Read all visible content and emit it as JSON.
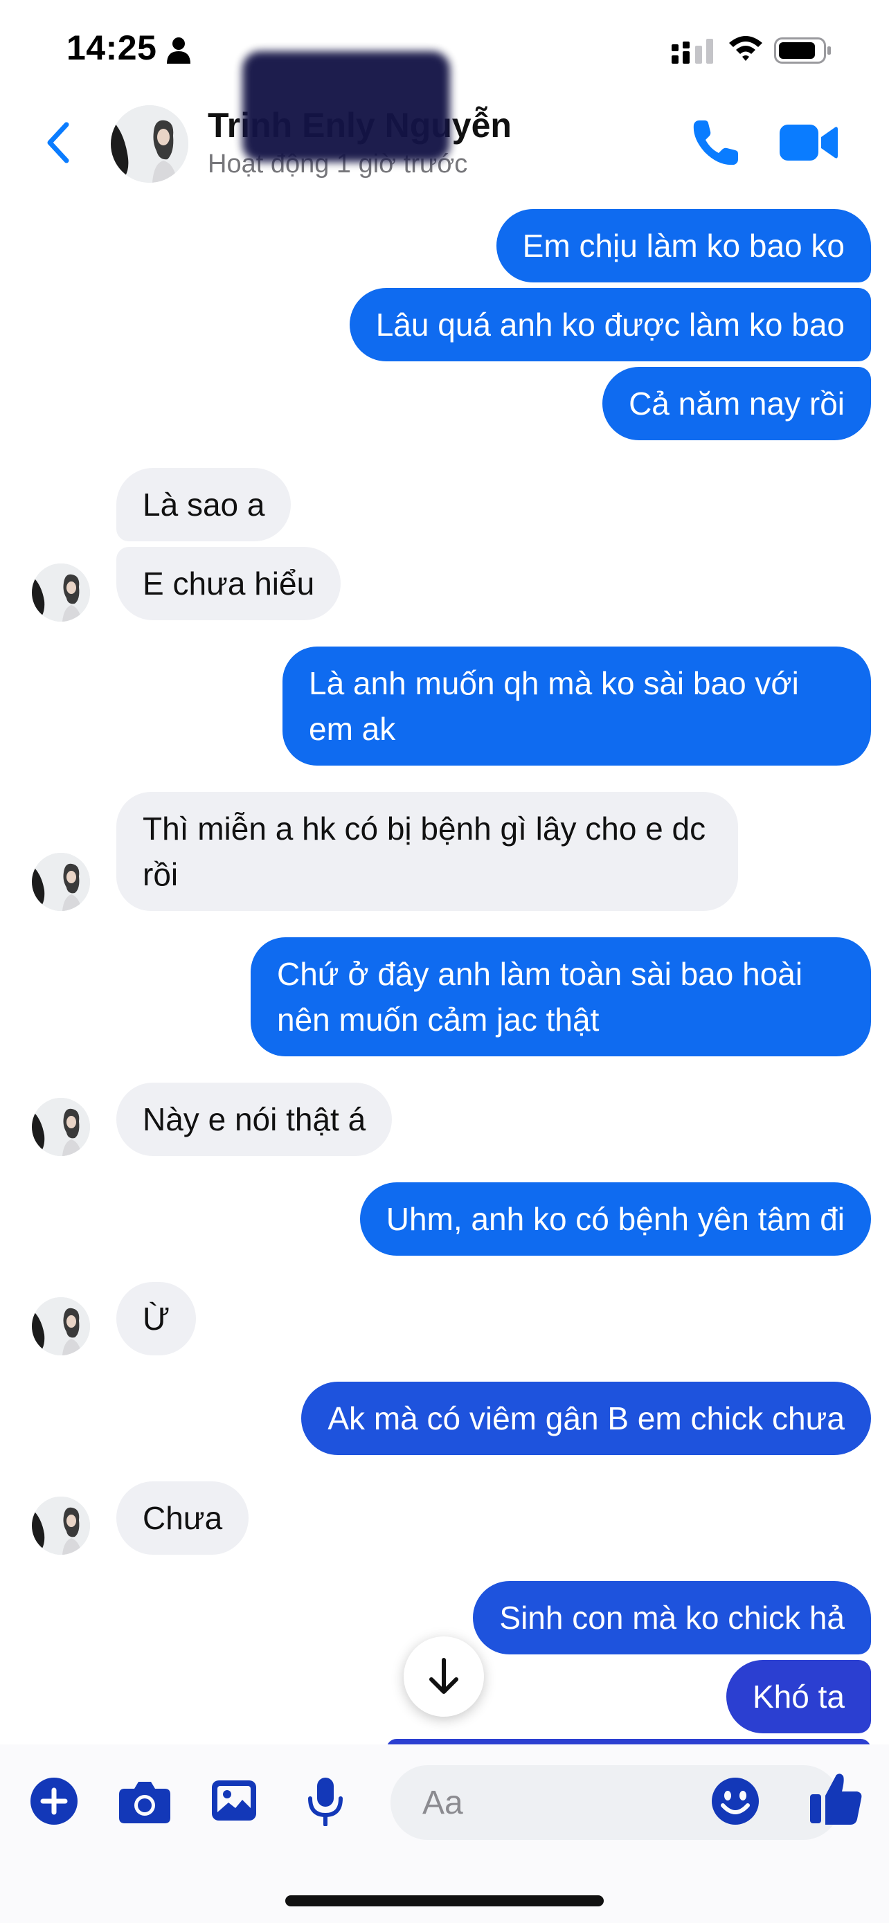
{
  "status_bar": {
    "time": "14:25"
  },
  "header": {
    "name": "Trinh Enly Nguyễn",
    "status": "Hoạt động 1 giờ trước"
  },
  "messages": [
    {
      "from": "me",
      "text": "Em chịu làm ko bao ko"
    },
    {
      "from": "me",
      "text": "Lâu quá anh ko được làm ko bao"
    },
    {
      "from": "me",
      "text": "Cả năm nay rồi"
    },
    {
      "from": "them",
      "text": "Là sao a"
    },
    {
      "from": "them",
      "text": "E chưa hiểu"
    },
    {
      "from": "me",
      "text": "Là anh muốn qh mà ko sài bao với em ak"
    },
    {
      "from": "them",
      "text": "Thì miễn a hk có bị bệnh gì lây cho e dc rồi"
    },
    {
      "from": "me",
      "text": "Chứ ở đây anh làm toàn sài bao hoài nên muốn cảm jac thật"
    },
    {
      "from": "them",
      "text": "Này e nói thật á"
    },
    {
      "from": "me",
      "text": "Uhm, anh ko có bệnh yên tâm đi"
    },
    {
      "from": "them",
      "text": "Ừ"
    },
    {
      "from": "me",
      "text": "Ak mà có viêm gân B em chick chưa"
    },
    {
      "from": "them",
      "text": "Chưa"
    },
    {
      "from": "me",
      "text": "Sinh con mà ko chick hả"
    },
    {
      "from": "me",
      "text": "Khó ta"
    }
  ],
  "composer": {
    "placeholder": "Aa"
  },
  "colors": {
    "accent": "#0a7cff",
    "outgoing_bubble": "#0f6bf0",
    "outgoing_bubble_deep": "#1e53dd",
    "incoming_bubble": "#eff0f4",
    "composer_icon": "#1338b8"
  },
  "icons": {
    "header": [
      "back-chevron-icon",
      "phone-icon",
      "video-camera-icon"
    ],
    "composer": [
      "plus-icon",
      "camera-icon",
      "photo-icon",
      "microphone-icon",
      "emoji-icon",
      "thumbs-up-icon"
    ],
    "scroll": "arrow-down-icon"
  }
}
